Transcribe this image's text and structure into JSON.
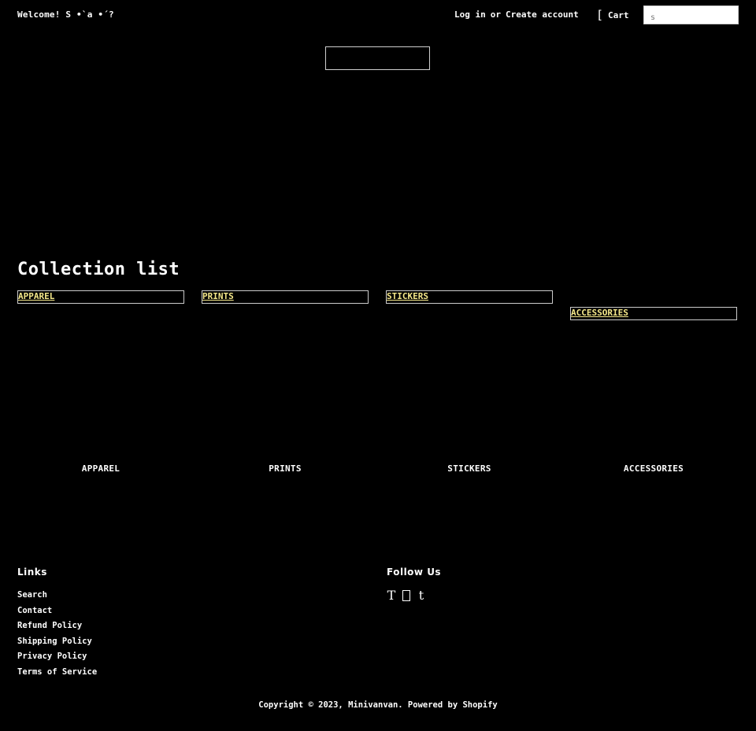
{
  "header": {
    "welcome": "Welcome! S •`a •´?",
    "login_label": "Log in",
    "or_label": "or",
    "create_account_label": "Create account",
    "cart_bracket": "[",
    "cart_label": "Cart",
    "search_placeholder": "s"
  },
  "collection_list": {
    "title": "Collection list",
    "items": [
      {
        "label": "APPAREL",
        "caption": "APPAREL"
      },
      {
        "label": "PRINTS",
        "caption": "PRINTS"
      },
      {
        "label": "STICKERS",
        "caption": "STICKERS"
      },
      {
        "label": "ACCESSORIES",
        "caption": "ACCESSORIES"
      }
    ]
  },
  "footer": {
    "links_heading": "Links",
    "links": [
      "Search",
      "Contact",
      "Refund Policy",
      "Shipping Policy",
      "Privacy Policy",
      "Terms of Service"
    ],
    "follow_heading": "Follow Us",
    "social_icons": [
      {
        "name": "twitter-icon",
        "glyph": "T"
      },
      {
        "name": "instagram-icon",
        "glyph": ""
      },
      {
        "name": "tumblr-icon",
        "glyph": "t"
      }
    ],
    "copyright": "Copyright © 2023, Minivanvan. Powered by Shopify"
  },
  "colors": {
    "background": "#000000",
    "text": "#ffffff",
    "collection_label": "#f5e88a"
  }
}
